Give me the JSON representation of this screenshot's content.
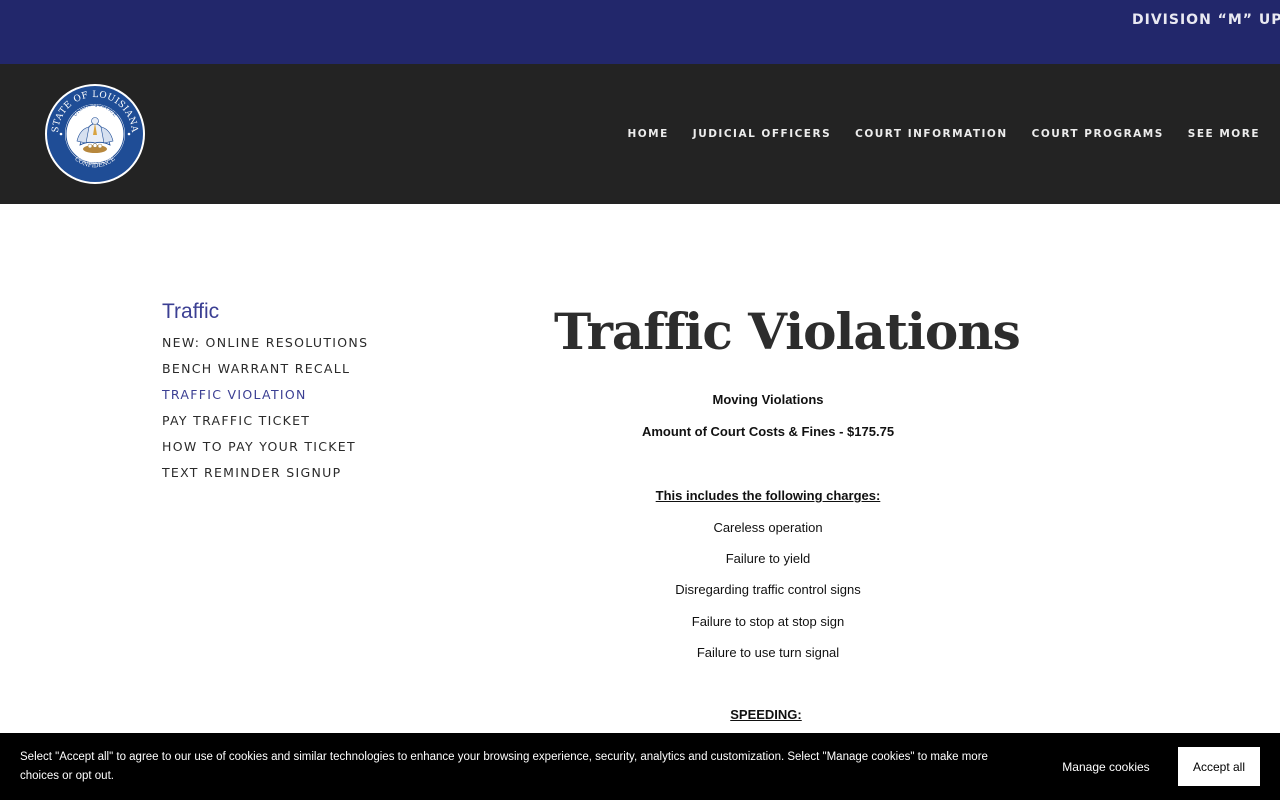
{
  "ticker": {
    "text": "DIVISION “M” UPDA"
  },
  "seal": {
    "top_text": "STATE OF LOUISIANA",
    "motto_top": "UNION · JUSTICE",
    "motto_bottom": "CONFIDENCE",
    "colors": {
      "ring": "#1f4d96",
      "inner": "#ffffff"
    }
  },
  "nav": {
    "items": [
      {
        "label": "HOME"
      },
      {
        "label": "JUDICIAL OFFICERS"
      },
      {
        "label": "COURT INFORMATION"
      },
      {
        "label": "COURT PROGRAMS"
      },
      {
        "label": "SEE MORE"
      }
    ]
  },
  "sidebar": {
    "title": "Traffic",
    "items": [
      {
        "label": "NEW: ONLINE RESOLUTIONS"
      },
      {
        "label": "BENCH WARRANT RECALL"
      },
      {
        "label": "TRAFFIC VIOLATION",
        "active": true
      },
      {
        "label": "PAY TRAFFIC TICKET"
      },
      {
        "label": "HOW TO PAY YOUR TICKET"
      },
      {
        "label": "TEXT REMINDER SIGNUP"
      }
    ]
  },
  "main": {
    "title": "Traffic Violations",
    "section_heading": "Moving Violations",
    "amount_line": "Amount of  Court Costs & Fines - $175.75",
    "includes_heading": "This includes the following charges:",
    "charges": [
      "Careless operation",
      "Failure to yield",
      "Disregarding traffic control signs",
      "Failure to stop at stop sign",
      "Failure to use turn signal"
    ],
    "speeding_heading": "SPEEDING:"
  },
  "cookie": {
    "text": "Select \"Accept all\" to agree to our use of cookies and similar technologies to enhance your browsing experience, security, analytics and customization. Select \"Manage cookies\" to make more choices or opt out.",
    "manage_label": "Manage cookies",
    "accept_label": "Accept all"
  },
  "colors": {
    "ticker_bg": "#22276b",
    "header_bg": "#232323",
    "accent": "#3b3f93",
    "cookie_bg": "#000000"
  }
}
